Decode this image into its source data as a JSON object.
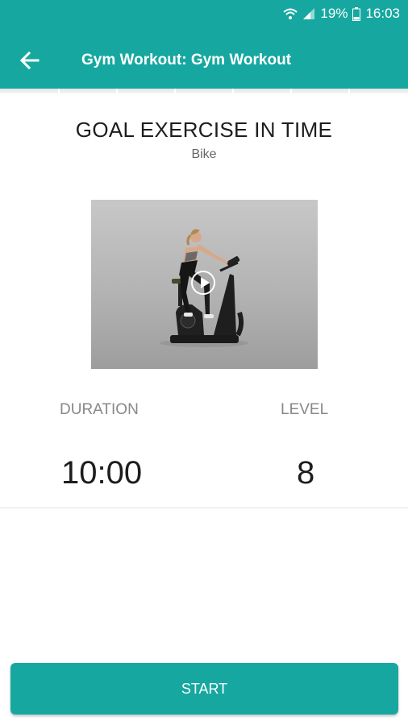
{
  "status_bar": {
    "battery_percent": "19%",
    "time": "16:03",
    "icons": [
      "wifi-icon",
      "signal-icon",
      "battery-icon"
    ]
  },
  "toolbar": {
    "back_icon": "arrow-left-icon",
    "title": "Gym Workout: Gym Workout",
    "background_color": "#16a8a0"
  },
  "exercise": {
    "goal_title": "GOAL EXERCISE IN TIME",
    "equipment": "Bike",
    "video_thumbnail": "woman-on-exercise-bike",
    "play_icon": "play-circle-icon"
  },
  "stats": {
    "duration_label": "DURATION",
    "duration_value": "10:00",
    "level_label": "LEVEL",
    "level_value": "8"
  },
  "actions": {
    "start_label": "START",
    "accent_color": "#16a8a0"
  }
}
